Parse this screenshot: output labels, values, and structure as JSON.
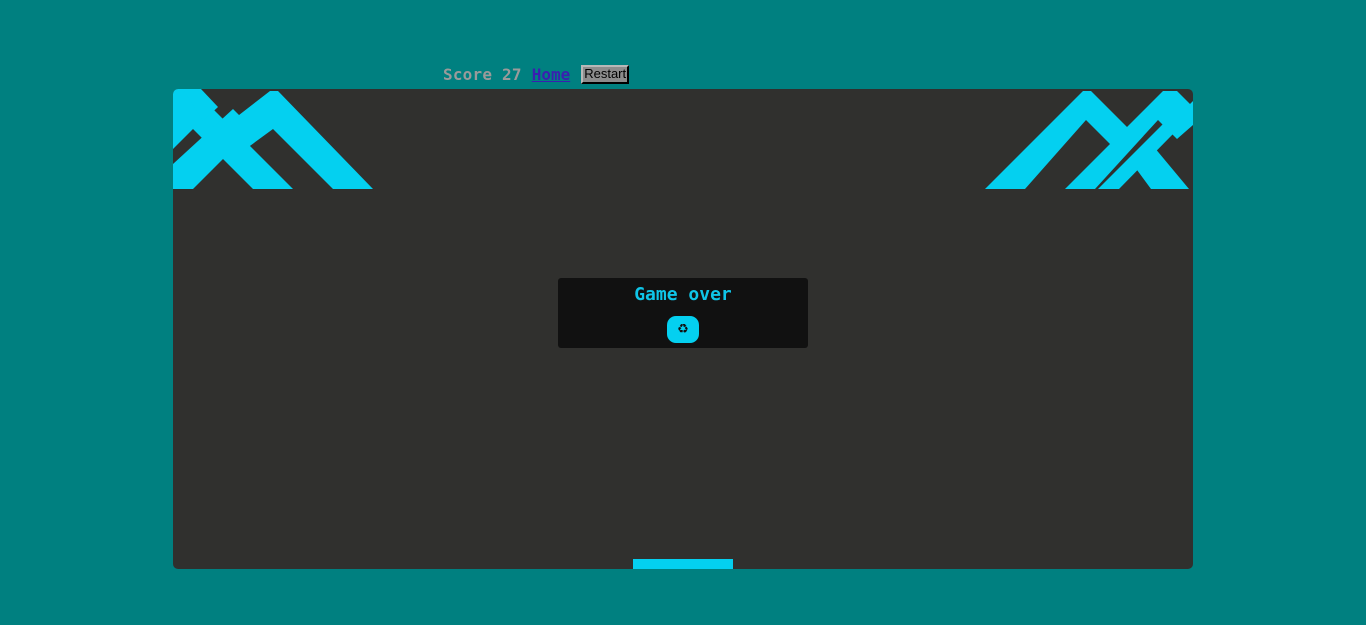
{
  "header": {
    "score_label": "Score",
    "score_value": "27",
    "home_link": "Home",
    "restart_button": "Restart"
  },
  "game_over_dialog": {
    "title": "Game over",
    "replay_icon": "recycle-icon",
    "replay_glyph": "♻"
  },
  "colors": {
    "page_background": "#008080",
    "board_background": "#30302e",
    "brick_color": "#04d0f0",
    "paddle_color": "#04d0f0",
    "dialog_background": "#111111",
    "dialog_title": "#0fc5e8"
  }
}
